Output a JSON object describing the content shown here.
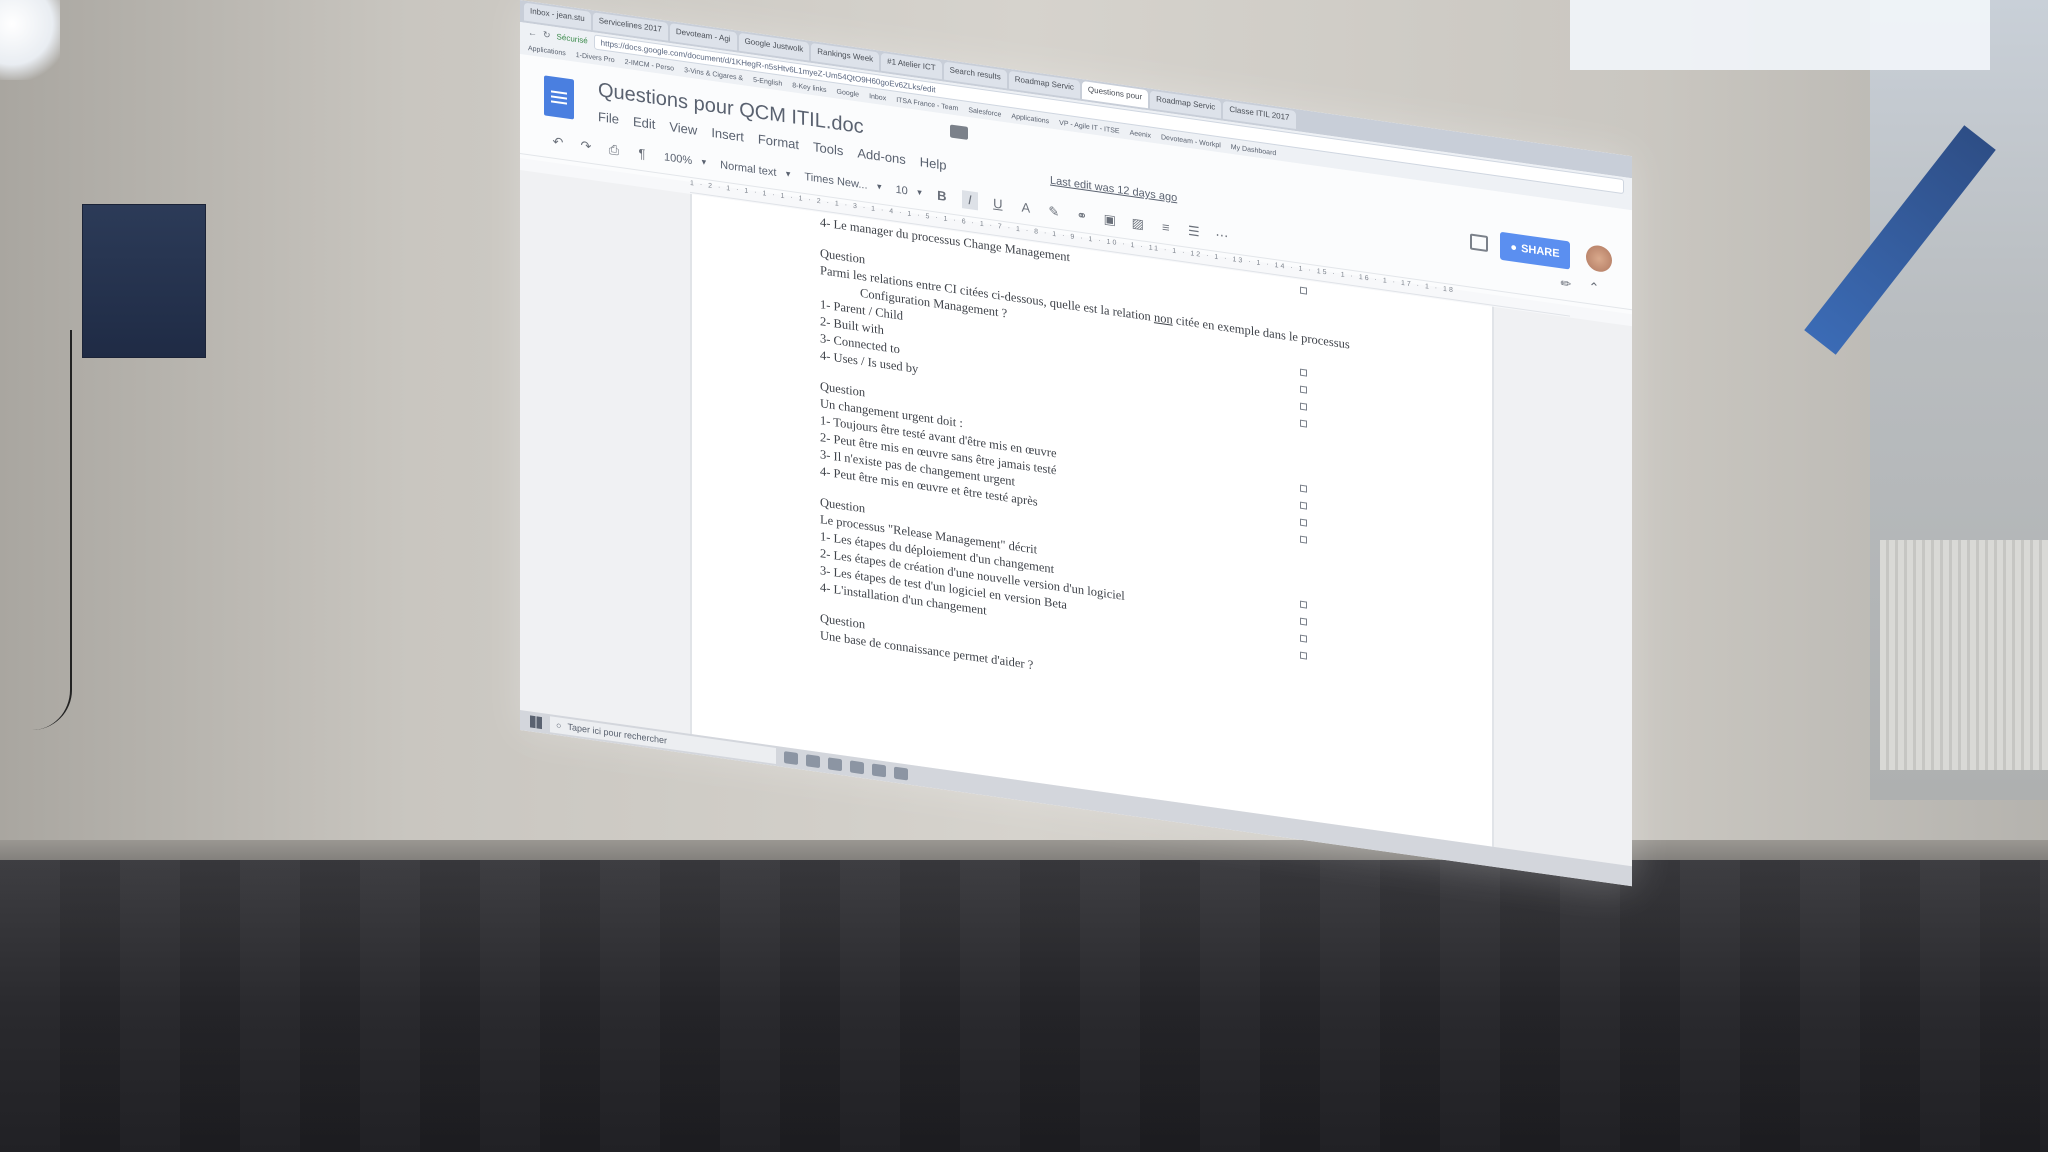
{
  "browser": {
    "tabs": [
      "Inbox - jean.stu",
      "Servicelines 2017",
      "Devoteam - Agi",
      "Google Justwolk",
      "Rankings Week",
      "#1 Atelier ICT",
      "Search results",
      "Roadmap Servic",
      "Questions pour",
      "Roadmap Servic",
      "Classe ITIL 2017"
    ],
    "secure_label": "Sécurisé",
    "url": "https://docs.google.com/document/d/1KHegR-n5sHtv6L1myeZ-Um54QtO9H60goEv6ZLks/edit",
    "bookmarks": [
      "Applications",
      "1-Divers Pro",
      "2-IMCM - Perso",
      "3-Vins & Cigares &",
      "5-English",
      "8-Key links",
      "Google",
      "Inbox",
      "ITSA France - Team",
      "Salesforce",
      "Applications",
      "VP - Agile IT - ITSE",
      "Aeenix",
      "Devoteam - Workpl",
      "My Dashboard"
    ]
  },
  "doc": {
    "title": "Questions pour QCM ITIL.doc",
    "menu": [
      "File",
      "Edit",
      "View",
      "Insert",
      "Format",
      "Tools",
      "Add-ons",
      "Help"
    ],
    "last_edit": "Last edit was 12 days ago",
    "share_label": "SHARE",
    "toolbar": {
      "zoom": "100%",
      "style": "Normal text",
      "font": "Times New...",
      "size": "10",
      "bold": "B",
      "italic": "I",
      "underline": "U",
      "text_color": "A"
    },
    "ruler": "1 · 2 · 1 · 1 · 1 · 1 · 1 · 2 · 1 · 3 · 1 · 4 · 1 · 5 · 1 · 6 · 1 · 7 · 1 · 8 · 1 · 9 · 1 · 10 · 1 · 11 · 1 · 12 · 1 · 13 · 1 · 14 · 1 · 15 · 1 · 16 · 1 · 17 · 1 · 18",
    "lines": {
      "prev_last": "4- Le manager du processus Change Management",
      "q1_head": "Question",
      "q1_text_a": "Parmi les relations entre CI citées ci-dessous, quelle est la relation ",
      "q1_text_u": "non",
      "q1_text_b": " citée en exemple dans le processus",
      "q1_text_c": "Configuration Management ?",
      "q1_opts": [
        "1- Parent / Child",
        "2- Built with",
        "3- Connected to",
        "4- Uses / Is used by"
      ],
      "q2_head": "Question",
      "q2_text": "Un changement urgent doit :",
      "q2_opts": [
        "1- Toujours être testé avant d'être mis en œuvre",
        "2- Peut être mis en œuvre sans être jamais testé",
        "3- Il n'existe pas de changement urgent",
        "4- Peut être mis en œuvre et être testé après"
      ],
      "q3_head": "Question",
      "q3_text": "Le processus \"Release Management\" décrit",
      "q3_opts": [
        "1- Les étapes du déploiement d'un changement",
        "2- Les étapes de création d'une nouvelle version d'un logiciel",
        "3- Les étapes de test d'un logiciel en version Beta",
        "4- L'installation d'un changement"
      ],
      "q4_head": "Question",
      "q4_text": "Une base de connaissance permet d'aider ?"
    }
  },
  "taskbar": {
    "search_placeholder": "Taper ici pour rechercher"
  }
}
